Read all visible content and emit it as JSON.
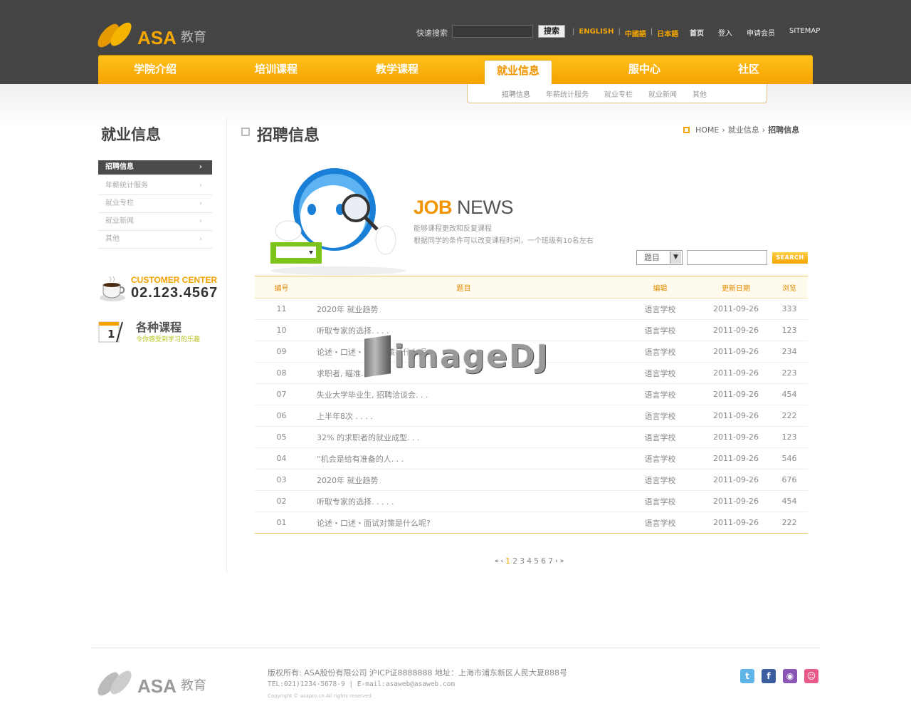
{
  "brand": {
    "name": "ASA",
    "sub": "教育"
  },
  "header": {
    "search_label": "快速搜索",
    "search_button": "搜索",
    "languages": [
      "ENGLISH",
      "中國語",
      "日本語"
    ],
    "links": [
      "首页",
      "登入",
      "申请会员",
      "SITEMAP"
    ]
  },
  "nav": {
    "items": [
      "学院介绍",
      "培训课程",
      "教学课程",
      "就业信息",
      "服中心",
      "社区"
    ],
    "active": "就业信息",
    "sub_items": [
      "招聘信息",
      "年薪统计服务",
      "就业专栏",
      "就业新闻",
      "其他"
    ]
  },
  "sidebar": {
    "title": "就业信息",
    "menu": [
      "招聘信息",
      "年薪统计服务",
      "就业专栏",
      "就业新闻",
      "其他"
    ],
    "customer_center_label": "CUSTOMER CENTER",
    "phone": "02.123.4567",
    "courses_title": "各种课程",
    "courses_sub": "令你感受到学习的乐趣",
    "calendar_day": "1"
  },
  "main": {
    "title": "招聘信息",
    "breadcrumb": [
      "HOME",
      "就业信息",
      "招聘信息"
    ],
    "banner_job": "JOB",
    "banner_news": "NEWS",
    "desc1": "能够课程更改和反复课程",
    "desc2": "根据同学的条件可以改变课程时间，一个班级有10名左右",
    "select_value": "题目",
    "search_button": "SEARCH"
  },
  "table": {
    "headers": [
      "编号",
      "题目",
      "编辑",
      "更新日期",
      "浏览"
    ],
    "rows": [
      [
        "11",
        "2020年 就业趋势",
        "语言学校",
        "2011-09-26",
        "333"
      ],
      [
        "10",
        "听取专家的选择. . . .",
        "语言学校",
        "2011-09-26",
        "123"
      ],
      [
        "09",
        "论述・口述・面试对策是什么呢?",
        "语言学校",
        "2011-09-26",
        "234"
      ],
      [
        "08",
        "求职者, 瞄准...",
        "语言学校",
        "2011-09-26",
        "223"
      ],
      [
        "07",
        "失业大学毕业生, 招聘洽谈会. . .",
        "语言学校",
        "2011-09-26",
        "454"
      ],
      [
        "06",
        "上半年8次 . . . .",
        "语言学校",
        "2011-09-26",
        "222"
      ],
      [
        "05",
        "32% 的求职者的就业成型. . .",
        "语言学校",
        "2011-09-26",
        "123"
      ],
      [
        "04",
        "“机会是给有准备的人. . .",
        "语言学校",
        "2011-09-26",
        "546"
      ],
      [
        "03",
        "2020年 就业趋势",
        "语言学校",
        "2011-09-26",
        "676"
      ],
      [
        "02",
        "听取专家的选择. . . . .",
        "语言学校",
        "2011-09-26",
        "454"
      ],
      [
        "01",
        "论述・口述・面试对策是什么呢?",
        "语言学校",
        "2011-09-26",
        "222"
      ]
    ]
  },
  "pagination": {
    "pages": [
      "1",
      "2",
      "3",
      "4",
      "5",
      "6",
      "7"
    ],
    "current": "1"
  },
  "watermark": "imageDJ",
  "footer": {
    "line1": "版权所有: ASA股份有限公司 沪ICP证8888888 地址：上海市浦东新区人民大夏888号",
    "line2": "TEL:021)1234-5678-9 | E-mail:asaweb@asaweb.com",
    "copyright": "Copyright © asapro.cn All rights reserved"
  },
  "social": [
    "twitter-icon",
    "facebook-icon",
    "rss-icon",
    "me2day-icon"
  ],
  "colors": {
    "accent": "#f5a100",
    "dark": "#444444"
  }
}
